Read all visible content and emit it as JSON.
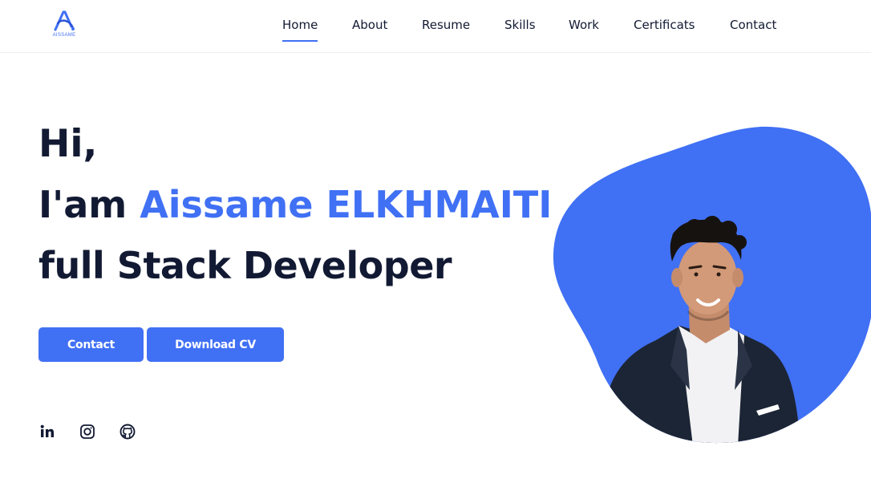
{
  "header": {
    "logo_text": "AISSAME",
    "nav": [
      {
        "label": "Home",
        "active": true
      },
      {
        "label": "About",
        "active": false
      },
      {
        "label": "Resume",
        "active": false
      },
      {
        "label": "Skills",
        "active": false
      },
      {
        "label": "Work",
        "active": false
      },
      {
        "label": "Certificats",
        "active": false
      },
      {
        "label": "Contact",
        "active": false
      }
    ]
  },
  "hero": {
    "greeting": "Hi,",
    "intro": "I'am ",
    "name": "Aissame ELKHMAITI",
    "role": "full Stack Developer"
  },
  "buttons": {
    "contact": "Contact",
    "download_cv": "Download CV"
  },
  "social": [
    {
      "icon": "linkedin-icon"
    },
    {
      "icon": "instagram-icon"
    },
    {
      "icon": "github-icon"
    }
  ],
  "colors": {
    "accent": "#4070f4",
    "text": "#121a33"
  }
}
